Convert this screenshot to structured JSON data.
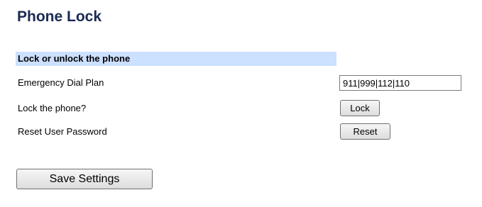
{
  "page": {
    "title": "Phone Lock"
  },
  "section": {
    "header": "Lock or unlock the phone"
  },
  "rows": {
    "emergency_dial_plan": {
      "label": "Emergency Dial Plan",
      "value": "911|999|112|110"
    },
    "lock_phone": {
      "label": "Lock the phone?",
      "button_label": "Lock"
    },
    "reset_password": {
      "label": "Reset User Password",
      "button_label": "Reset"
    }
  },
  "actions": {
    "save_label": "Save Settings"
  }
}
